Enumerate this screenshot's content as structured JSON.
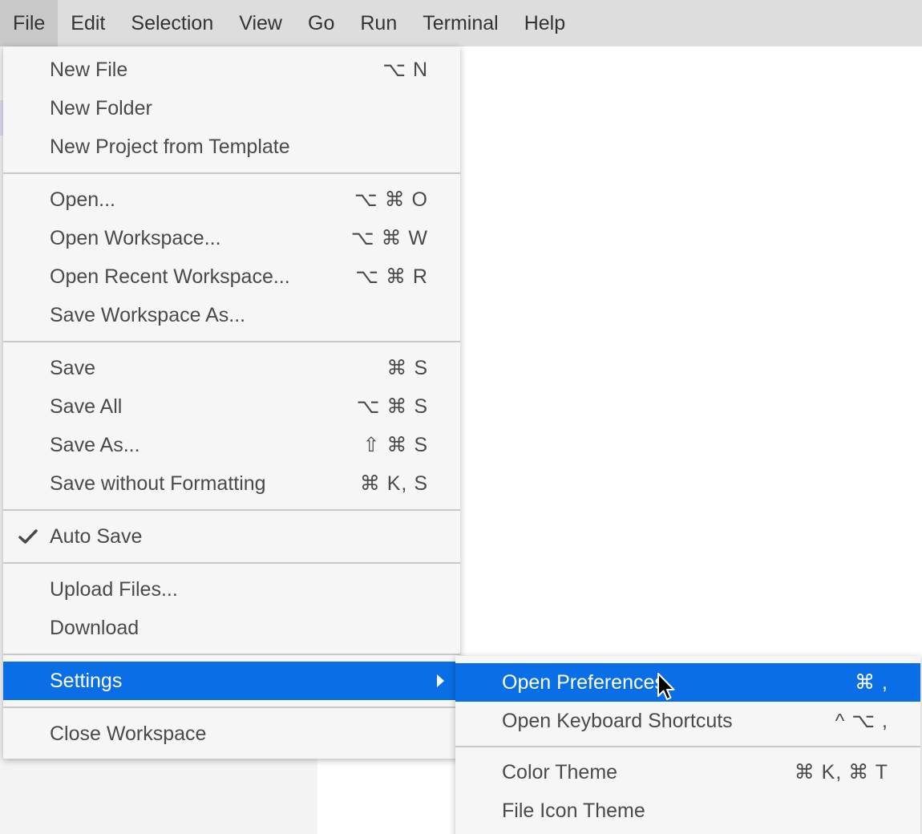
{
  "menubar": {
    "items": [
      "File",
      "Edit",
      "Selection",
      "View",
      "Go",
      "Run",
      "Terminal",
      "Help"
    ],
    "active": "File"
  },
  "file_menu": {
    "new_file": {
      "label": "New File",
      "shortcut": "⌥ N"
    },
    "new_folder": {
      "label": "New Folder"
    },
    "new_project": {
      "label": "New Project from Template"
    },
    "open": {
      "label": "Open...",
      "shortcut": "⌥ ⌘ O"
    },
    "open_workspace": {
      "label": "Open Workspace...",
      "shortcut": "⌥ ⌘ W"
    },
    "open_recent": {
      "label": "Open Recent Workspace...",
      "shortcut": "⌥ ⌘ R"
    },
    "save_workspace_as": {
      "label": "Save Workspace As..."
    },
    "save": {
      "label": "Save",
      "shortcut": "⌘ S"
    },
    "save_all": {
      "label": "Save All",
      "shortcut": "⌥ ⌘ S"
    },
    "save_as": {
      "label": "Save As...",
      "shortcut": "⇧ ⌘ S"
    },
    "save_without_formatting": {
      "label": "Save without Formatting",
      "shortcut": "⌘ K, S"
    },
    "auto_save": {
      "label": "Auto Save",
      "checked": true
    },
    "upload_files": {
      "label": "Upload Files..."
    },
    "download": {
      "label": "Download"
    },
    "settings": {
      "label": "Settings",
      "highlighted": true
    },
    "close_workspace": {
      "label": "Close Workspace"
    }
  },
  "settings_menu": {
    "open_preferences": {
      "label": "Open Preferences",
      "shortcut": "⌘ ,",
      "highlighted": true
    },
    "open_keyboard_shortcuts": {
      "label": "Open Keyboard Shortcuts",
      "shortcut": "^ ⌥ ,"
    },
    "color_theme": {
      "label": "Color Theme",
      "shortcut": "⌘ K, ⌘ T"
    },
    "file_icon_theme": {
      "label": "File Icon Theme"
    }
  },
  "colors": {
    "highlight": "#0a6fe6",
    "menubar_bg": "#dddddd",
    "menu_bg": "#f6f6f6",
    "text": "#4a4a4a"
  },
  "icons": {
    "check": "check-icon",
    "submenu": "chevron-right-icon",
    "cursor": "mouse-pointer-icon"
  }
}
